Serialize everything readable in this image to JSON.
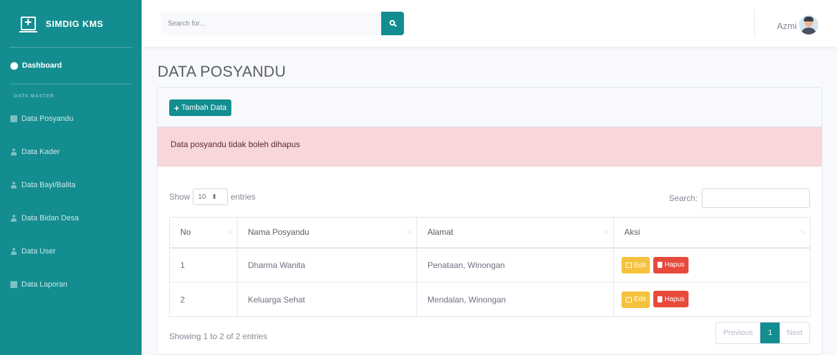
{
  "brand": {
    "name": "SIMDIG KMS",
    "icon": "laptop-medical-icon"
  },
  "sidebar": {
    "dashboard": "Dashboard",
    "heading": "DATA MASTER",
    "items": [
      {
        "label": "Data Posyandu",
        "icon": "table-icon"
      },
      {
        "label": "Data Kader",
        "icon": "user-icon"
      },
      {
        "label": "Data Bayi/Balita",
        "icon": "baby-icon"
      },
      {
        "label": "Data Bidan Desa",
        "icon": "user-icon"
      },
      {
        "label": "Data User",
        "icon": "user-icon"
      },
      {
        "label": "Data Laporan",
        "icon": "table-icon"
      }
    ]
  },
  "topbar": {
    "search_placeholder": "Search for...",
    "user_name": "Azmi"
  },
  "page": {
    "title": "DATA POSYANDU",
    "add_button": "Tambah Data",
    "alert": "Data posyandu tidak boleh dihapus"
  },
  "datatable": {
    "show_label": "Show",
    "entries_value": "10",
    "entries_label": "entries",
    "search_label": "Search:",
    "columns": [
      "No",
      "Nama Posyandu",
      "Alamat",
      "Aksi"
    ],
    "rows": [
      {
        "no": "1",
        "nama": "Dharma Wanita",
        "alamat": "Penataan, Winongan"
      },
      {
        "no": "2",
        "nama": "Keluarga Sehat",
        "alamat": "Mendalan, Winongan"
      }
    ],
    "edit_label": "Edit",
    "delete_label": "Hapus",
    "info": "Showing 1 to 2 of 2 entries",
    "prev": "Previous",
    "current_page": "1",
    "next": "Next"
  },
  "colors": {
    "accent": "#138d90",
    "warning": "#f6c23e",
    "danger": "#e74a3b",
    "alert_bg": "#f8d7da"
  }
}
